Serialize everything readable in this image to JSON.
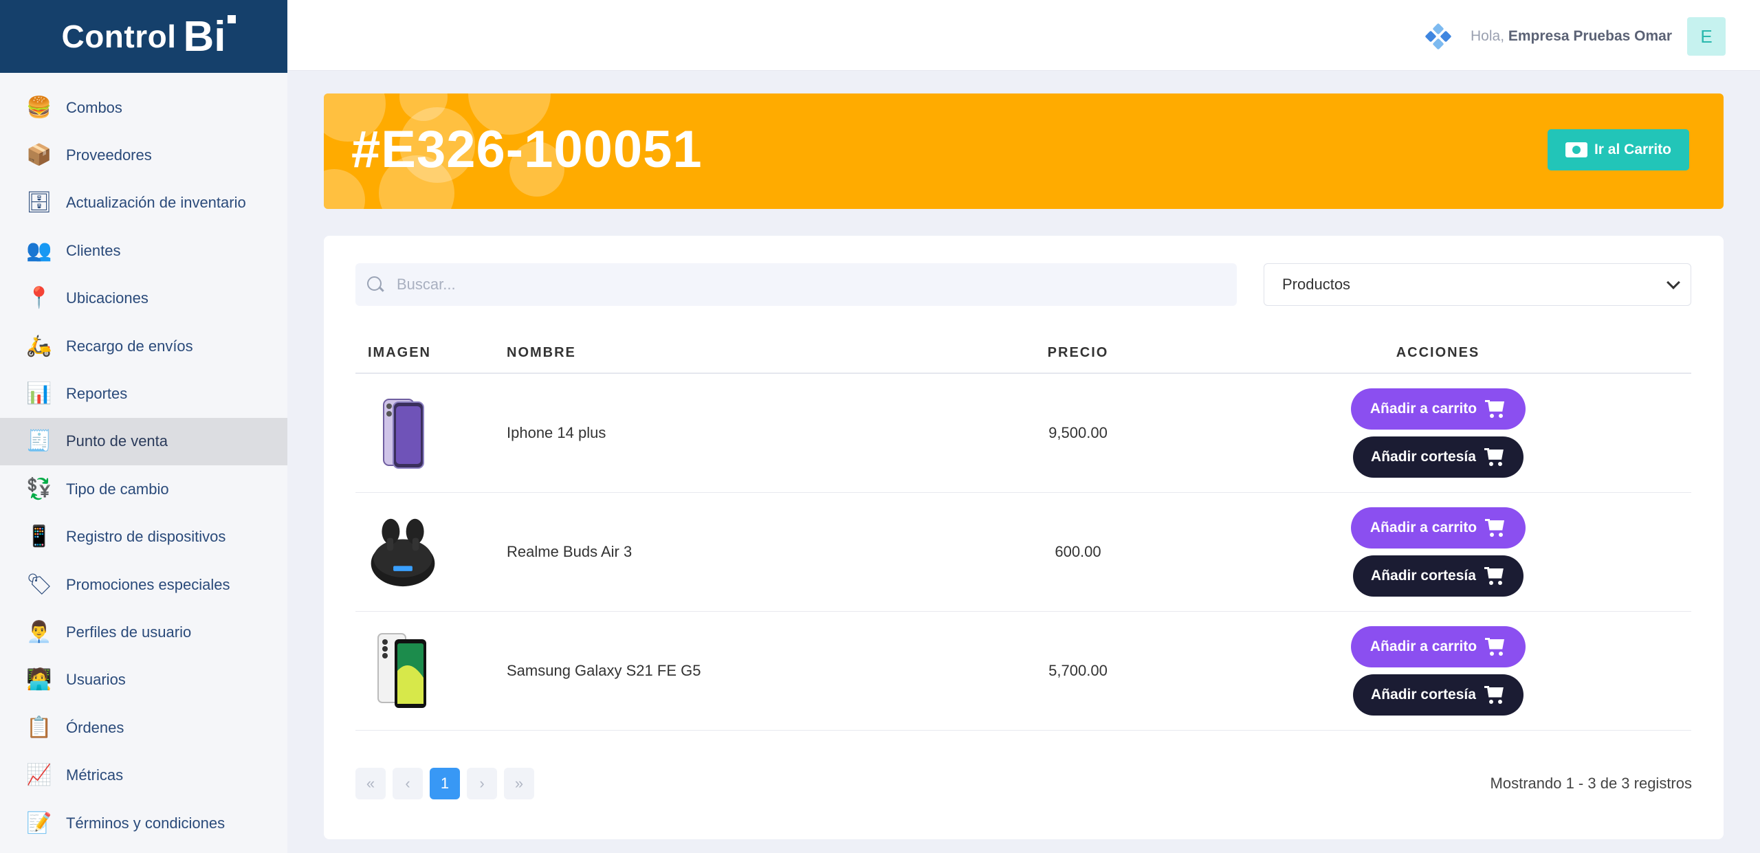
{
  "brand": {
    "name": "Control",
    "suffix": "Bi"
  },
  "sidebar": {
    "items": [
      {
        "label": "Combos",
        "icon": "combos-icon",
        "glyph": "🍔"
      },
      {
        "label": "Proveedores",
        "icon": "suppliers-icon",
        "glyph": "📦"
      },
      {
        "label": "Actualización de inventario",
        "icon": "inventory-icon",
        "glyph": "🗄"
      },
      {
        "label": "Clientes",
        "icon": "clients-icon",
        "glyph": "👥"
      },
      {
        "label": "Ubicaciones",
        "icon": "locations-icon",
        "glyph": "📍"
      },
      {
        "label": "Recargo de envíos",
        "icon": "delivery-icon",
        "glyph": "🛵"
      },
      {
        "label": "Reportes",
        "icon": "reports-icon",
        "glyph": "📊"
      },
      {
        "label": "Punto de venta",
        "icon": "pos-icon",
        "glyph": "🧾",
        "active": true
      },
      {
        "label": "Tipo de cambio",
        "icon": "exchange-icon",
        "glyph": "💱"
      },
      {
        "label": "Registro de dispositivos",
        "icon": "devices-icon",
        "glyph": "📱"
      },
      {
        "label": "Promociones especiales",
        "icon": "promotions-icon",
        "glyph": "🏷"
      },
      {
        "label": "Perfiles de usuario",
        "icon": "user-profile-icon",
        "glyph": "👨‍💼"
      },
      {
        "label": "Usuarios",
        "icon": "users-icon",
        "glyph": "🧑‍💻"
      },
      {
        "label": "Órdenes",
        "icon": "orders-icon",
        "glyph": "📋"
      },
      {
        "label": "Métricas",
        "icon": "metrics-icon",
        "glyph": "📈"
      },
      {
        "label": "Términos y condiciones",
        "icon": "terms-icon",
        "glyph": "📝"
      }
    ]
  },
  "header": {
    "greeting": "Hola,",
    "user": "Empresa Pruebas Omar",
    "avatar_letter": "E"
  },
  "banner": {
    "order_id": "#E326-100051",
    "cart_button": "Ir al Carrito",
    "color": "#ffab00"
  },
  "filters": {
    "search_placeholder": "Buscar...",
    "category_selected": "Productos"
  },
  "table": {
    "columns": {
      "image": "IMAGEN",
      "name": "NOMBRE",
      "price": "PRECIO",
      "actions": "ACCIONES"
    },
    "rows": [
      {
        "name": "Iphone 14 plus",
        "price": "9,500.00",
        "image": "iphone-image"
      },
      {
        "name": "Realme Buds Air 3",
        "price": "600.00",
        "image": "earbuds-image"
      },
      {
        "name": "Samsung Galaxy S21 FE G5",
        "price": "5,700.00",
        "image": "samsung-image"
      }
    ],
    "add_label": "Añadir a carrito",
    "courtesy_label": "Añadir cortesía"
  },
  "pagination": {
    "first": "«",
    "prev": "‹",
    "current": "1",
    "next": "›",
    "last": "»",
    "summary": "Mostrando 1 - 3 de 3 registros"
  }
}
